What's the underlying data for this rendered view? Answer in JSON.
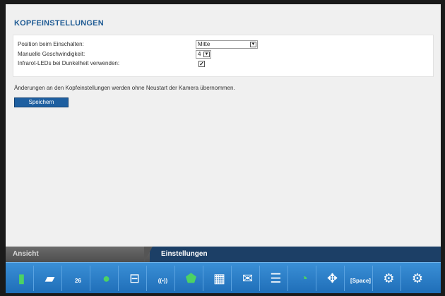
{
  "page": {
    "title": "KOPFEINSTELLUNGEN"
  },
  "settings": {
    "position_label": "Position beim Einschalten:",
    "position_value": "Mitte",
    "speed_label": "Manuelle Geschwindigkeit:",
    "speed_value": "4",
    "ir_label": "Infrarot-LEDs bei Dunkelheit verwenden:",
    "ir_checked": true,
    "ir_check_glyph": "✓"
  },
  "info_text": "Änderungen an den Kopfeinstellungen werden ohne Neustart der Kamera übernommen.",
  "save_label": "Speichern",
  "tabs": {
    "ansicht": "Ansicht",
    "einstellungen": "Einstellungen"
  },
  "toolbar": {
    "items": [
      {
        "name": "traffic-light-icon",
        "glyph": "🚦"
      },
      {
        "name": "camera-icon",
        "glyph": "📹"
      },
      {
        "name": "calendar-icon",
        "glyph": "26"
      },
      {
        "name": "user-icon",
        "glyph": "👤"
      },
      {
        "name": "network-icon",
        "glyph": "⊟"
      },
      {
        "name": "wireless-icon",
        "glyph": "((•))"
      },
      {
        "name": "shield-icon",
        "glyph": "🛡"
      },
      {
        "name": "web-icon",
        "glyph": "🌐"
      },
      {
        "name": "mail-icon",
        "glyph": "✉"
      },
      {
        "name": "storage-icon",
        "glyph": "☰"
      },
      {
        "name": "clock-icon",
        "glyph": "🕒"
      },
      {
        "name": "move-icon",
        "glyph": "✥"
      },
      {
        "name": "space-icon",
        "glyph": "[Space]"
      },
      {
        "name": "gear-icon",
        "glyph": "⚙"
      },
      {
        "name": "gear-arrow-icon",
        "glyph": "⚙"
      }
    ]
  },
  "colors": {
    "title": "#1f5b94",
    "button": "#1e5fa0",
    "toolbar": "#2a80cc"
  }
}
